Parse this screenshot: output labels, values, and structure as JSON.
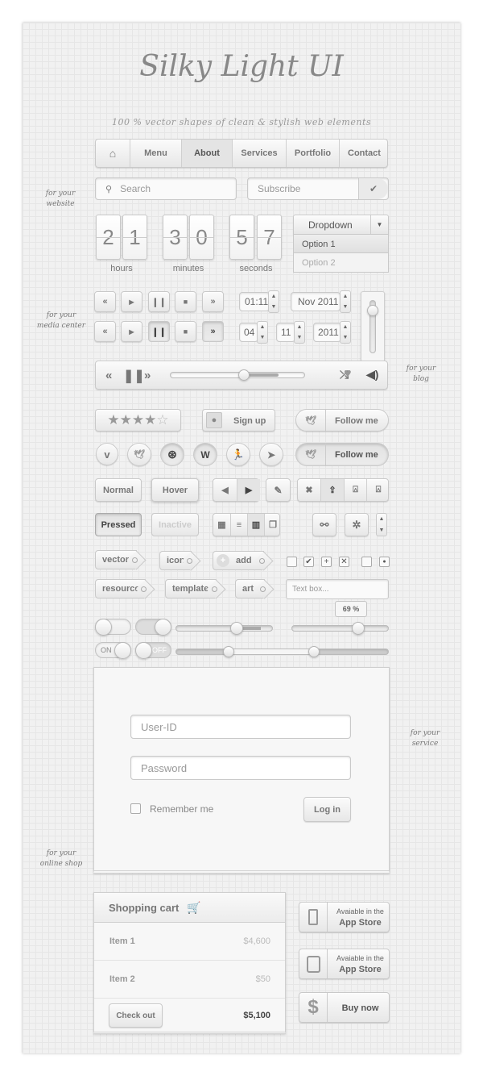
{
  "header": {
    "title": "Silky Light UI",
    "subtitle": "100 % vector shapes of clean & stylish web elements"
  },
  "annotations": {
    "website": "for your website",
    "media": "for your media center",
    "blog": "for your blog",
    "service": "for your service",
    "shop": "for your online shop"
  },
  "nav": {
    "items": [
      {
        "label": "Menu"
      },
      {
        "label": "About",
        "active": true
      },
      {
        "label": "Services"
      },
      {
        "label": "Portfolio"
      },
      {
        "label": "Contact"
      }
    ]
  },
  "search": {
    "placeholder": "Search"
  },
  "subscribe": {
    "placeholder": "Subscribe"
  },
  "countdown": {
    "hours": [
      "2",
      "1"
    ],
    "minutes": [
      "3",
      "0"
    ],
    "seconds": [
      "5",
      "7"
    ],
    "labels": {
      "hours": "hours",
      "minutes": "minutes",
      "seconds": "seconds"
    }
  },
  "dropdown": {
    "label": "Dropdown",
    "options": [
      "Option 1",
      "Option 2"
    ]
  },
  "spinners": {
    "time": "01:11",
    "month": "Nov 2011",
    "day": "04",
    "mon": "11",
    "year": "2011"
  },
  "player": {
    "progress": 0.55,
    "buffered": 0.8,
    "volume": 0.8
  },
  "rating": {
    "stars": "★★★★",
    "empty": "☆",
    "value": 4,
    "max": 5
  },
  "buttons": {
    "signup": "Sign up",
    "follow": "Follow me",
    "follow_pressed": "Follow me",
    "normal": "Normal",
    "hover": "Hover",
    "pressed": "Pressed",
    "inactive": "Inactive",
    "login": "Log in",
    "checkout": "Check out",
    "buy": "Buy now"
  },
  "tags": [
    "vector",
    "icon",
    "add",
    "resource",
    "template",
    "art"
  ],
  "textbox": {
    "placeholder": "Text box..."
  },
  "sliders": {
    "tooltip": "69 %",
    "value": 0.69,
    "range": [
      0.25,
      0.65
    ],
    "toggle_on": "ON",
    "toggle_off": "OFF"
  },
  "login": {
    "user_placeholder": "User-ID",
    "pass_placeholder": "Password",
    "remember": "Remember me"
  },
  "cart": {
    "title": "Shopping cart",
    "items": [
      {
        "name": "Item 1",
        "price": "$4,600"
      },
      {
        "name": "Item 2",
        "price": "$50"
      }
    ],
    "total": "$5,100"
  },
  "store": {
    "line1": "Avaiable in the",
    "line2": "App Store",
    "dollar": "$"
  }
}
